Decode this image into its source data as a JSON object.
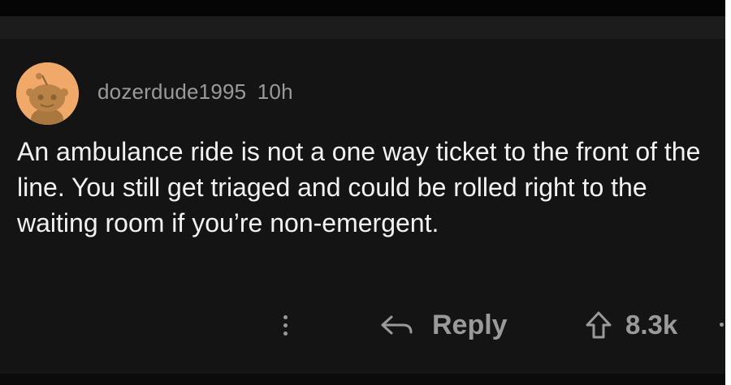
{
  "comment": {
    "username": "dozerdude1995",
    "timestamp": "10h",
    "body": "An ambulance ride is not a one way ticket to the front of the line. You still get triaged and could be rolled right to the waiting room if you’re non-emergent."
  },
  "actions": {
    "reply_label": "Reply",
    "score": "8.3k"
  },
  "icons": {
    "avatar": "snoo-avatar-icon",
    "more": "vertical-ellipsis-icon",
    "reply": "reply-arrow-icon",
    "upvote": "upvote-arrow-icon"
  },
  "colors": {
    "background": "#141414",
    "body_text": "#f2f2f2",
    "meta_text": "#9a9a9a",
    "avatar_bg": "#f1a96a"
  }
}
